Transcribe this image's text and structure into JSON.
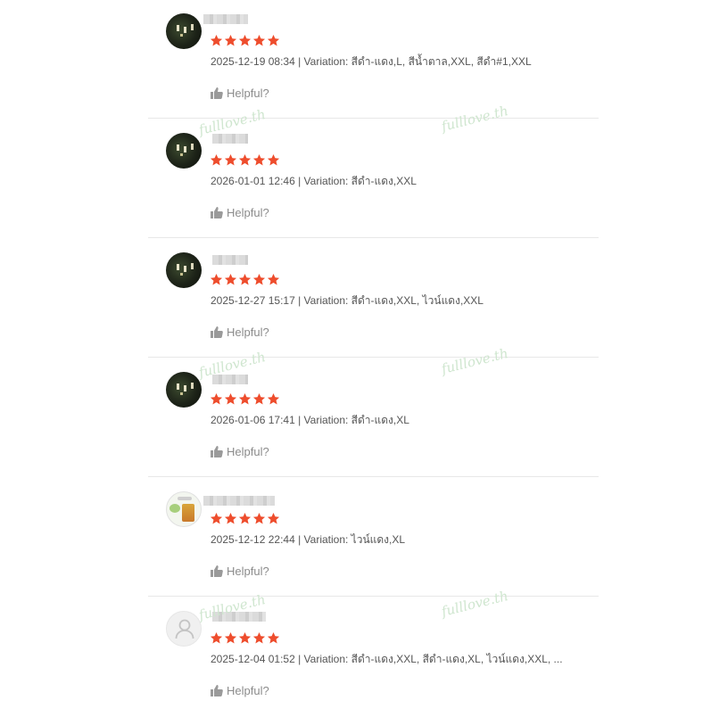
{
  "accent_color": "#ee4d2d",
  "watermark_text": "fulllove.th",
  "helpful_label": "Helpful?",
  "reviews": [
    {
      "avatar": "dark-photo-avatar",
      "rating": 5,
      "meta": "2025-12-19 08:34 | Variation: สีดำ-แดง,L, สีน้ำตาล,XXL, สีดำ#1,XXL"
    },
    {
      "avatar": "dark-photo-avatar",
      "rating": 5,
      "meta": "2026-01-01 12:46 | Variation: สีดำ-แดง,XXL"
    },
    {
      "avatar": "dark-photo-avatar",
      "rating": 5,
      "meta": "2025-12-27 15:17 | Variation: สีดำ-แดง,XXL, ไวน์แดง,XXL"
    },
    {
      "avatar": "dark-photo-avatar",
      "rating": 5,
      "meta": "2026-01-06 17:41 | Variation: สีดำ-แดง,XL"
    },
    {
      "avatar": "product-bag-avatar",
      "rating": 5,
      "meta": "2025-12-12 22:44 | Variation: ไวน์แดง,XL"
    },
    {
      "avatar": "default-user-avatar",
      "rating": 5,
      "meta": "2025-12-04 01:52 | Variation: สีดำ-แดง,XXL, สีดำ-แดง,XL, ไวน์แดง,XXL, ..."
    }
  ]
}
